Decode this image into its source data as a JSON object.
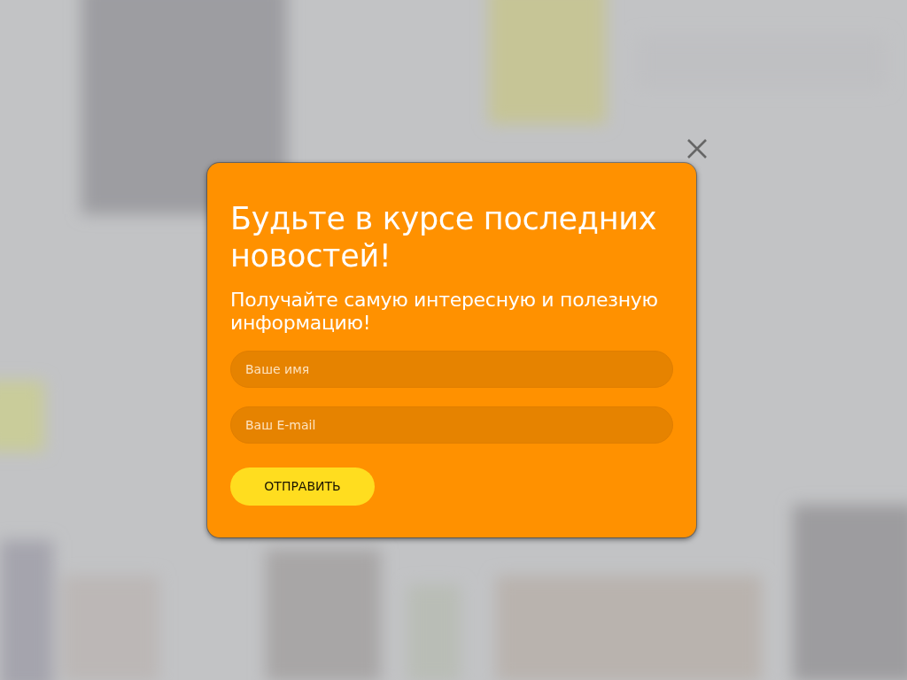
{
  "popup": {
    "title": "Будьте в курсе последних новостей!",
    "subtitle": "Получайте самую интересную и полезную информацию!",
    "fields": [
      {
        "placeholder": "Ваше имя"
      },
      {
        "placeholder": "Ваш E-mail"
      }
    ],
    "submit_button": "ОТПРАВИТЬ"
  }
}
